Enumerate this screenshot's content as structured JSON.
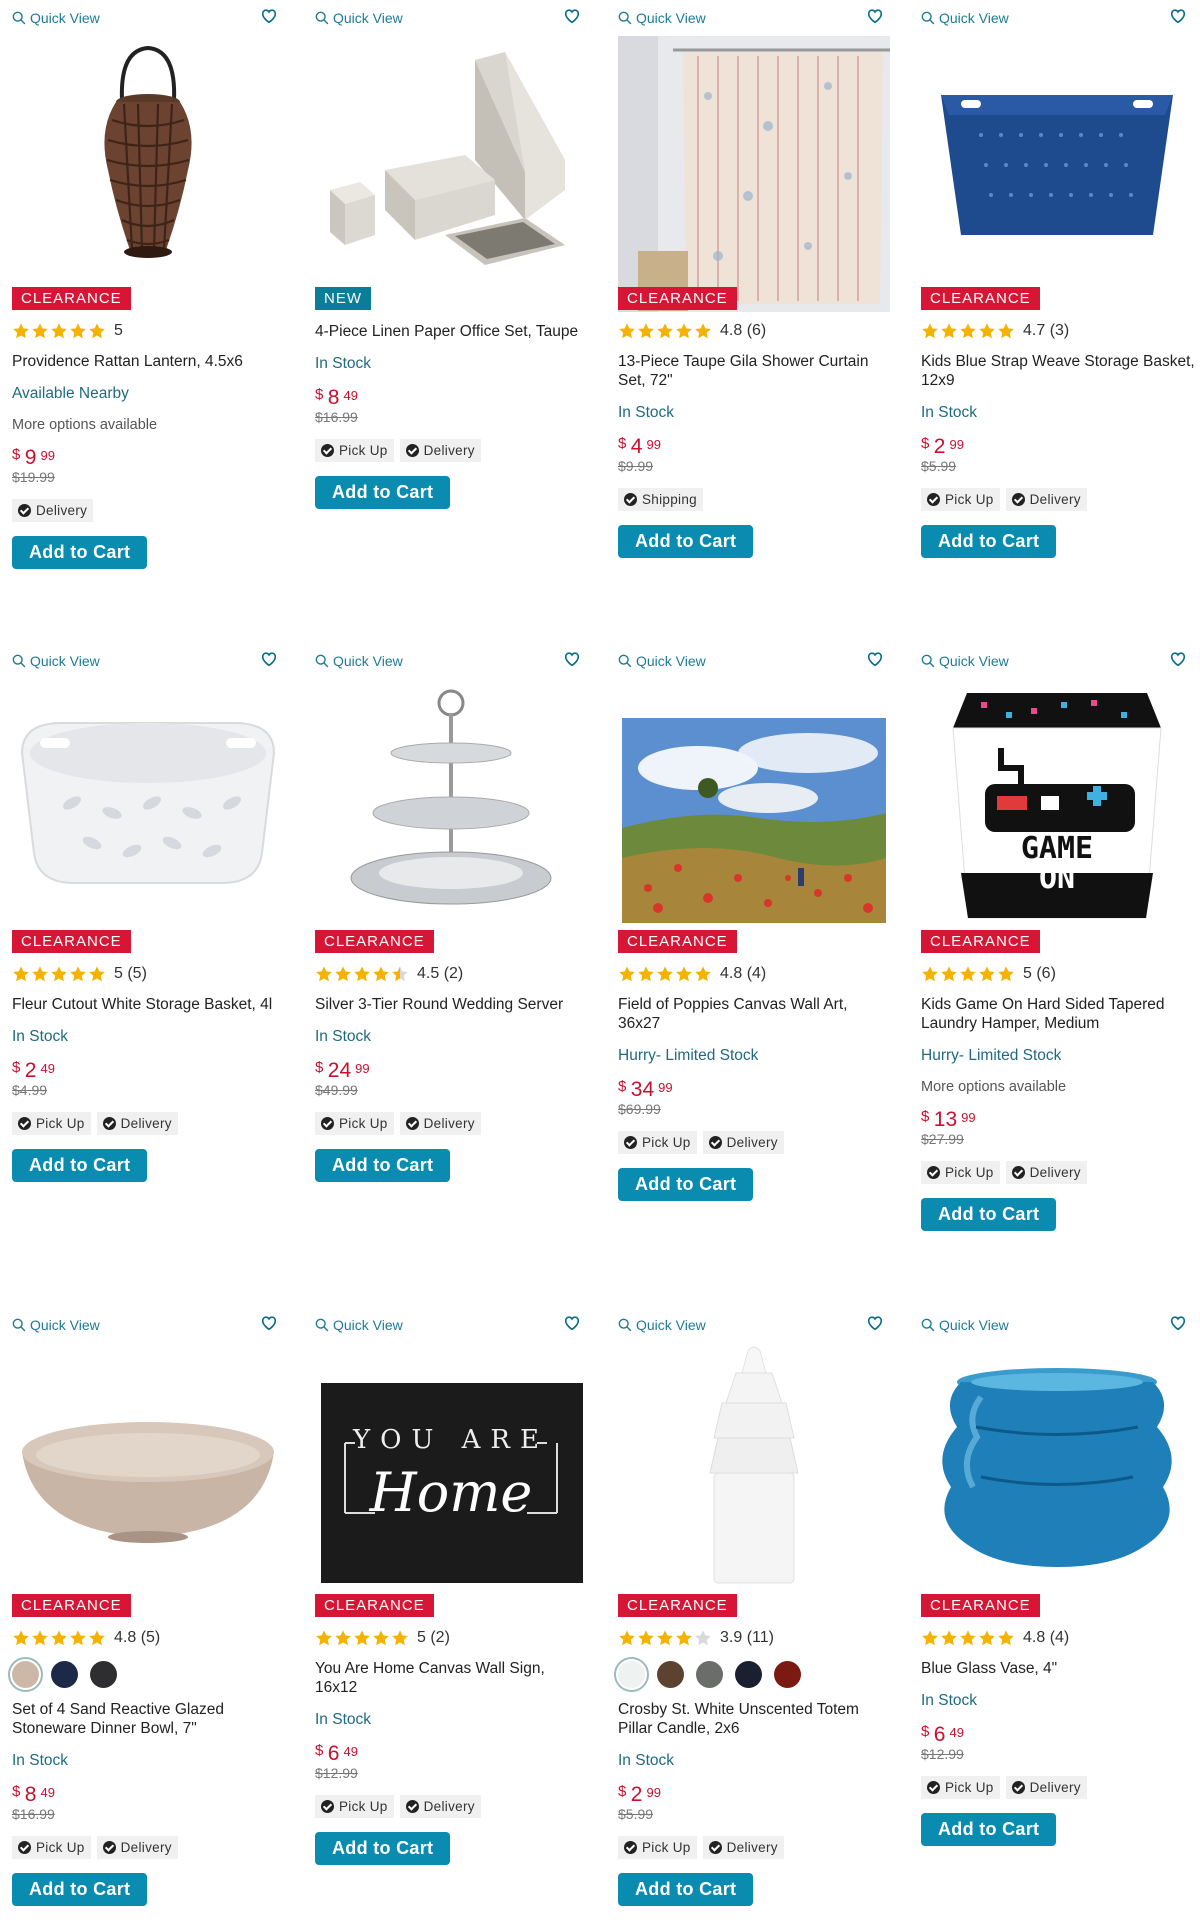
{
  "ui": {
    "quick_view": "Quick View",
    "add_to_cart": "Add to Cart",
    "currency": "$",
    "colors": {
      "accent": "#0a8bb0",
      "clearance": "#d71534",
      "new": "#0a7d98",
      "price": "#c8102e",
      "star": "#f5b301",
      "stock": "#1f6a80"
    }
  },
  "products": [
    {
      "badge": "CLEARANCE",
      "rating": "5",
      "name": "Providence Rattan Lantern, 4.5x6",
      "stock": "Available Nearby",
      "more": "More options available",
      "dollars": "9",
      "cents": "99",
      "was": "$19.99",
      "chip1": "Delivery",
      "chip2": "",
      "icon": "rattan-lantern-image"
    },
    {
      "badge": "NEW",
      "rating": "",
      "name": "4-Piece Linen Paper Office Set, Taupe",
      "stock": "In Stock",
      "more": "",
      "dollars": "8",
      "cents": "49",
      "was": "$16.99",
      "chip1": "Pick Up",
      "chip2": "Delivery",
      "icon": "office-set-image"
    },
    {
      "badge": "CLEARANCE",
      "rating": "4.8 (6)",
      "name": "13-Piece Taupe Gila Shower Curtain Set, 72\"",
      "stock": "In Stock",
      "more": "",
      "dollars": "4",
      "cents": "99",
      "was": "$9.99",
      "chip1": "Shipping",
      "chip2": "",
      "icon": "shower-curtain-image"
    },
    {
      "badge": "CLEARANCE",
      "rating": "4.7 (3)",
      "name": "Kids Blue Strap Weave Storage Basket, 12x9",
      "stock": "In Stock",
      "more": "",
      "dollars": "2",
      "cents": "99",
      "was": "$5.99",
      "chip1": "Pick Up",
      "chip2": "Delivery",
      "icon": "blue-basket-image"
    },
    {
      "badge": "CLEARANCE",
      "rating": "5 (5)",
      "name": "Fleur Cutout White Storage Basket, 4l",
      "stock": "In Stock",
      "more": "",
      "dollars": "2",
      "cents": "49",
      "was": "$4.99",
      "chip1": "Pick Up",
      "chip2": "Delivery",
      "icon": "white-basket-image"
    },
    {
      "badge": "CLEARANCE",
      "rating": "4.5 (2)",
      "name": "Silver 3-Tier Round Wedding Server",
      "stock": "In Stock",
      "more": "",
      "dollars": "24",
      "cents": "99",
      "was": "$49.99",
      "chip1": "Pick Up",
      "chip2": "Delivery",
      "icon": "tier-server-image"
    },
    {
      "badge": "CLEARANCE",
      "rating": "4.8 (4)",
      "name": "Field of Poppies Canvas Wall Art, 36x27",
      "stock": "Hurry- Limited Stock",
      "more": "",
      "dollars": "34",
      "cents": "99",
      "was": "$69.99",
      "chip1": "Pick Up",
      "chip2": "Delivery",
      "icon": "poppies-art-image"
    },
    {
      "badge": "CLEARANCE",
      "rating": "5 (6)",
      "name": "Kids Game On Hard Sided Tapered Laundry Hamper, Medium",
      "stock": "Hurry- Limited Stock",
      "more": "More options available",
      "dollars": "13",
      "cents": "99",
      "was": "$27.99",
      "chip1": "Pick Up",
      "chip2": "Delivery",
      "icon": "game-hamper-image",
      "art_text": [
        "GAME",
        "ON"
      ]
    },
    {
      "badge": "CLEARANCE",
      "rating": "4.8 (5)",
      "name": "Set of 4 Sand Reactive Glazed Stoneware Dinner Bowl, 7\"",
      "stock": "In Stock",
      "more": "",
      "dollars": "8",
      "cents": "49",
      "was": "$16.99",
      "chip1": "Pick Up",
      "chip2": "Delivery",
      "icon": "dinner-bowl-image",
      "swatches": [
        "#cdb8a8",
        "#1c2a48",
        "#2e2e30"
      ]
    },
    {
      "badge": "CLEARANCE",
      "rating": "5 (2)",
      "name": "You Are Home Canvas Wall Sign, 16x12",
      "stock": "In Stock",
      "more": "",
      "dollars": "6",
      "cents": "49",
      "was": "$12.99",
      "chip1": "Pick Up",
      "chip2": "Delivery",
      "icon": "home-sign-image",
      "art_text": [
        "YOU ARE",
        "Home"
      ]
    },
    {
      "badge": "CLEARANCE",
      "rating": "3.9 (11)",
      "name": "Crosby St. White Unscented Totem Pillar Candle, 2x6",
      "stock": "In Stock",
      "more": "",
      "dollars": "2",
      "cents": "99",
      "was": "$5.99",
      "chip1": "Pick Up",
      "chip2": "Delivery",
      "icon": "totem-candle-image",
      "swatches": [
        "#eef2f0",
        "#5b4330",
        "#6a6d6a",
        "#1a2030",
        "#7a1a12"
      ]
    },
    {
      "badge": "CLEARANCE",
      "rating": "4.8 (4)",
      "name": "Blue Glass Vase, 4\"",
      "stock": "In Stock",
      "more": "",
      "dollars": "6",
      "cents": "49",
      "was": "$12.99",
      "chip1": "Pick Up",
      "chip2": "Delivery",
      "icon": "glass-vase-image"
    }
  ]
}
